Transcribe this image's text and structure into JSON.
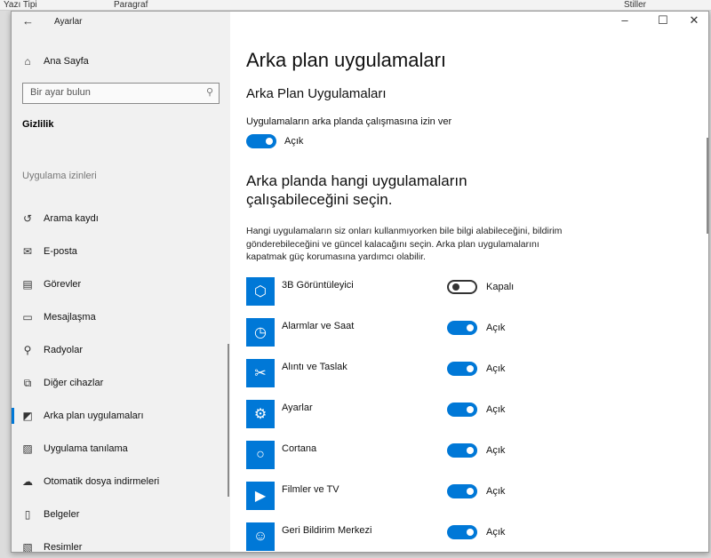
{
  "background_app": {
    "ribbon_groups": [
      "Yazı Tipi",
      "Paragraf",
      "Stiller"
    ]
  },
  "window": {
    "title": "Ayarlar",
    "controls": {
      "minimize": "–",
      "maximize": "☐",
      "close": "✕"
    }
  },
  "sidebar": {
    "home_label": "Ana Sayfa",
    "search_placeholder": "Bir ayar bulun",
    "section_title": "Gizlilik",
    "group_title": "Uygulama izinleri",
    "items": [
      {
        "label": "Arama kaydı",
        "icon": "history-icon"
      },
      {
        "label": "E-posta",
        "icon": "mail-icon"
      },
      {
        "label": "Görevler",
        "icon": "clipboard-icon"
      },
      {
        "label": "Mesajlaşma",
        "icon": "message-icon"
      },
      {
        "label": "Radyolar",
        "icon": "antenna-icon"
      },
      {
        "label": "Diğer cihazlar",
        "icon": "devices-icon"
      },
      {
        "label": "Arka plan uygulamaları",
        "icon": "background-apps-icon",
        "active": true
      },
      {
        "label": "Uygulama tanılama",
        "icon": "diagnostics-icon"
      },
      {
        "label": "Otomatik dosya indirmeleri",
        "icon": "cloud-icon"
      },
      {
        "label": "Belgeler",
        "icon": "document-icon"
      },
      {
        "label": "Resimler",
        "icon": "picture-icon"
      }
    ]
  },
  "main": {
    "title": "Arka plan uygulamaları",
    "subtitle": "Arka Plan Uygulamaları",
    "allow_label": "Uygulamaların arka planda çalışmasına izin ver",
    "allow_state": "Açık",
    "choose_heading": "Arka planda hangi uygulamaların çalışabileceğini seçin.",
    "description": "Hangi uygulamaların siz onları kullanmıyorken bile bilgi alabileceğini, bildirim gönderebileceğini ve güncel kalacağını seçin. Arka plan uygulamalarını kapatmak güç korumasına yardımcı olabilir.",
    "apps": [
      {
        "name": "3B Görüntüleyici",
        "state": "Kapalı",
        "on": false
      },
      {
        "name": "Alarmlar ve Saat",
        "state": "Açık",
        "on": true
      },
      {
        "name": "Alıntı ve Taslak",
        "state": "Açık",
        "on": true
      },
      {
        "name": "Ayarlar",
        "state": "Açık",
        "on": true
      },
      {
        "name": "Cortana",
        "state": "Açık",
        "on": true
      },
      {
        "name": "Filmler ve TV",
        "state": "Açık",
        "on": true
      },
      {
        "name": "Geri Bildirim Merkezi",
        "state": "Açık",
        "on": true
      }
    ]
  },
  "colors": {
    "accent": "#0078d7"
  }
}
